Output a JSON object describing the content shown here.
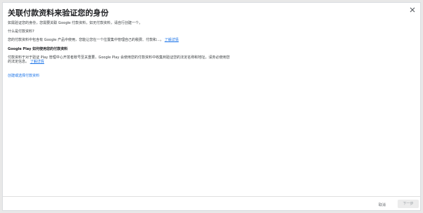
{
  "dialog": {
    "title": "关联付款资料来验证您的身份",
    "close_icon": "close-icon"
  },
  "content": {
    "intro": "如需验证您的身份，您需要关联 Google 付款资料。如无付款资料，请自行创建一个。",
    "what_heading": "什么是付款资料?",
    "what_text": "您的付款资料中包含有 Google 产品中使用，您能让您在一个位置集中管理自己的税费、付款和…。",
    "what_link": "了解详情",
    "how_heading": "Google Play 如何使用您的付款资料",
    "how_text_1": "付款资料于对于验证 Play 管理中心开发者账号至关重要。Google Play 会使用您的付款资料中收集到验证您的法定名称和地址。请务必使用您",
    "how_text_2": "的法定信息。",
    "how_link": "了解详情",
    "create_link": "创建或选择付款资料"
  },
  "footer": {
    "cancel_label": "取消",
    "next_label": "下一步"
  },
  "colors": {
    "link": "#1a73e8",
    "text": "#202124",
    "disabled_button_bg": "#ececec"
  }
}
